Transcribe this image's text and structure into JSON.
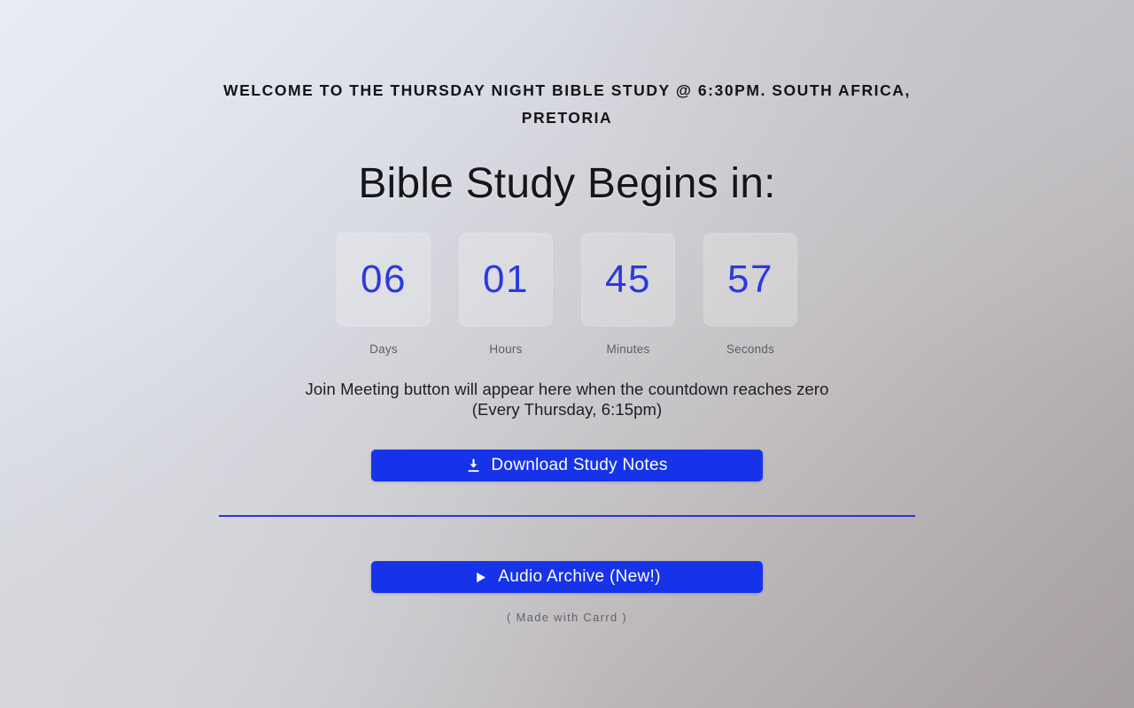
{
  "colors": {
    "accent_blue": "#1733ea",
    "digit_blue": "#2a3ae0",
    "divider_blue": "#2a36d8",
    "heading_text": "#131318",
    "label_text": "#5d5d63",
    "bg_top_left": "#e8ebf3",
    "bg_top_right": "#c2c2c8",
    "bg_bottom_left": "#d6d7dc",
    "bg_bottom_right": "#a69fa1"
  },
  "header": {
    "welcome": "Welcome to the Thursday Night Bible Study @ 6:30pm. South Africa, Pretoria",
    "title": "Bible Study Begins in:"
  },
  "countdown": {
    "units": [
      {
        "value": "06",
        "label": "Days"
      },
      {
        "value": "01",
        "label": "Hours"
      },
      {
        "value": "45",
        "label": "Minutes"
      },
      {
        "value": "57",
        "label": "Seconds"
      }
    ]
  },
  "note": {
    "line1": "Join Meeting button will appear here when the countdown reaches zero",
    "line2": "(Every Thursday, 6:15pm)"
  },
  "actions": {
    "download": {
      "label": "Download Study Notes",
      "icon": "download-icon"
    },
    "audio": {
      "label": "Audio Archive (New!)",
      "icon": "play-icon"
    }
  },
  "footer": {
    "credit": "( Made with Carrd )"
  }
}
